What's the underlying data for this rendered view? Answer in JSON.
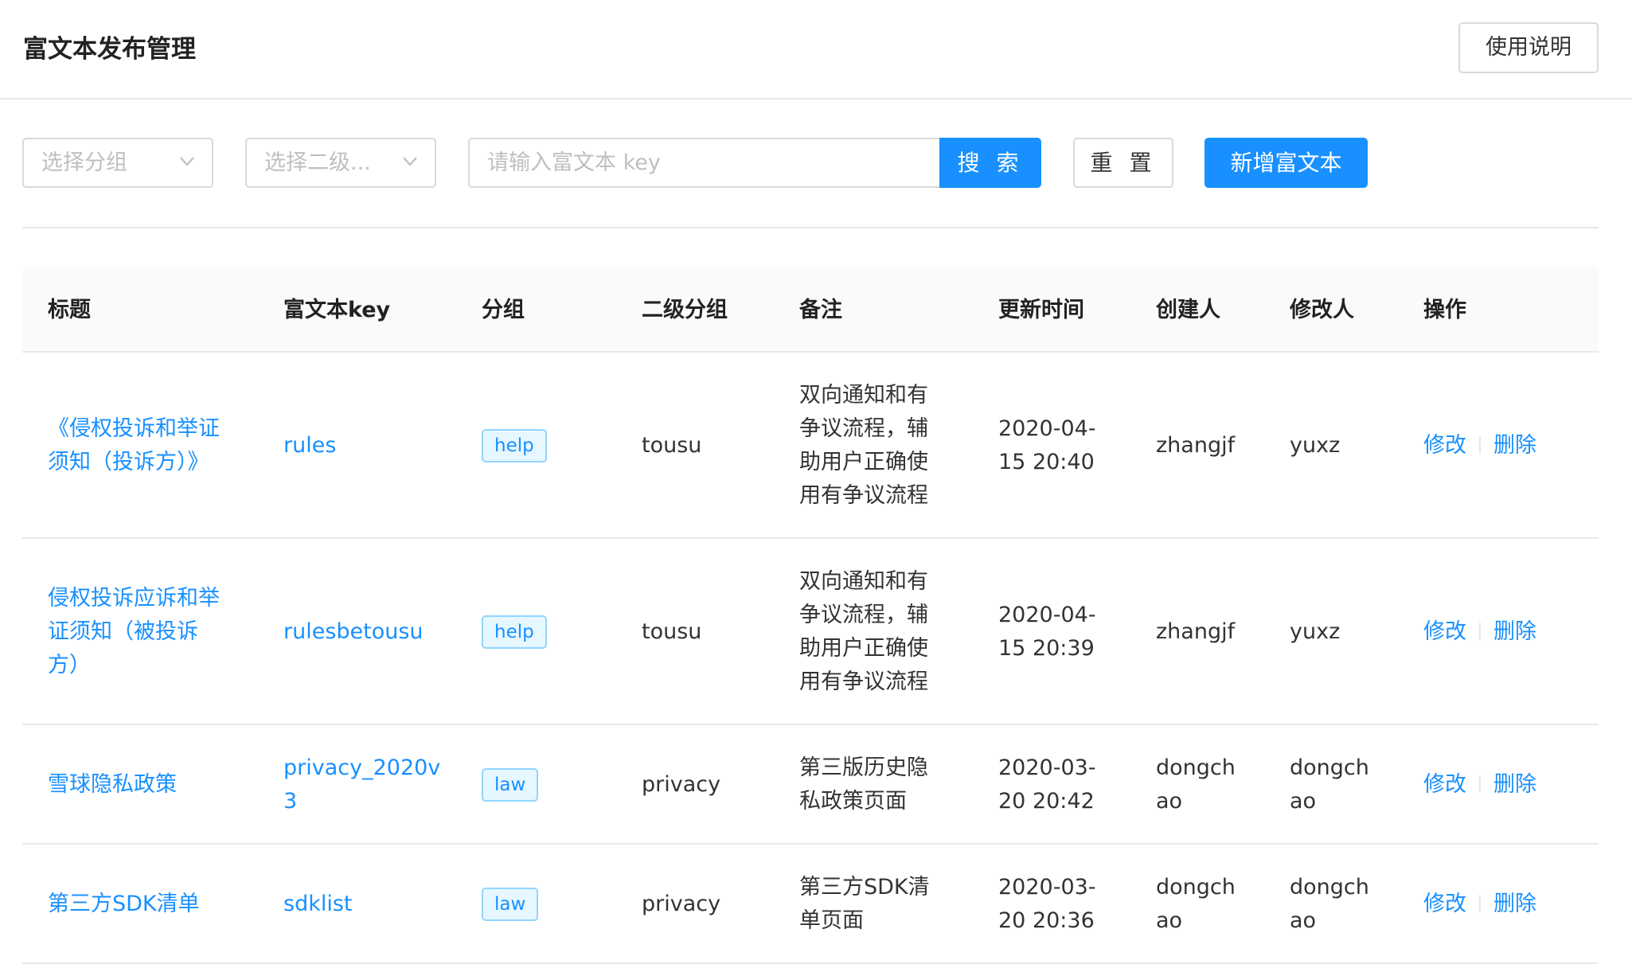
{
  "header": {
    "title": "富文本发布管理",
    "help_label": "使用说明"
  },
  "filters": {
    "group_placeholder": "选择分组",
    "subgroup_placeholder": "选择二级...",
    "search_placeholder": "请输入富文本 key",
    "search_label": "搜 索",
    "reset_label": "重 置",
    "add_label": "新增富文本"
  },
  "table": {
    "columns": [
      "标题",
      "富文本key",
      "分组",
      "二级分组",
      "备注",
      "更新时间",
      "创建人",
      "修改人",
      "操作"
    ],
    "rows": [
      {
        "title_lines": [
          "《侵权投诉和举证",
          "须知（投诉方）》"
        ],
        "key_lines": [
          "rules"
        ],
        "group": "help",
        "subgroup": "tousu",
        "remark_lines": [
          "双向通知和有",
          "争议流程，辅",
          "助用户正确使",
          "用有争议流程"
        ],
        "updated_lines": [
          "2020-04-",
          "15 20:40"
        ],
        "creator_lines": [
          "zhangjf"
        ],
        "modifier_lines": [
          "yuxz"
        ],
        "edit": "修改",
        "delete": "删除"
      },
      {
        "title_lines": [
          "侵权投诉应诉和举",
          "证须知（被投诉",
          "方）"
        ],
        "key_lines": [
          "rulesbetousu"
        ],
        "group": "help",
        "subgroup": "tousu",
        "remark_lines": [
          "双向通知和有",
          "争议流程，辅",
          "助用户正确使",
          "用有争议流程"
        ],
        "updated_lines": [
          "2020-04-",
          "15 20:39"
        ],
        "creator_lines": [
          "zhangjf"
        ],
        "modifier_lines": [
          "yuxz"
        ],
        "edit": "修改",
        "delete": "删除"
      },
      {
        "title_lines": [
          "雪球隐私政策"
        ],
        "key_lines": [
          "privacy_2020v",
          "3"
        ],
        "group": "law",
        "subgroup": "privacy",
        "remark_lines": [
          "第三版历史隐",
          "私政策页面"
        ],
        "updated_lines": [
          "2020-03-",
          "20 20:42"
        ],
        "creator_lines": [
          "dongch",
          "ao"
        ],
        "modifier_lines": [
          "dongch",
          "ao"
        ],
        "edit": "修改",
        "delete": "删除"
      },
      {
        "title_lines": [
          "第三方SDK清单"
        ],
        "key_lines": [
          "sdklist"
        ],
        "group": "law",
        "subgroup": "privacy",
        "remark_lines": [
          "第三方SDK清",
          "单页面"
        ],
        "updated_lines": [
          "2020-03-",
          "20 20:36"
        ],
        "creator_lines": [
          "dongch",
          "ao"
        ],
        "modifier_lines": [
          "dongch",
          "ao"
        ],
        "edit": "修改",
        "delete": "删除"
      }
    ]
  }
}
